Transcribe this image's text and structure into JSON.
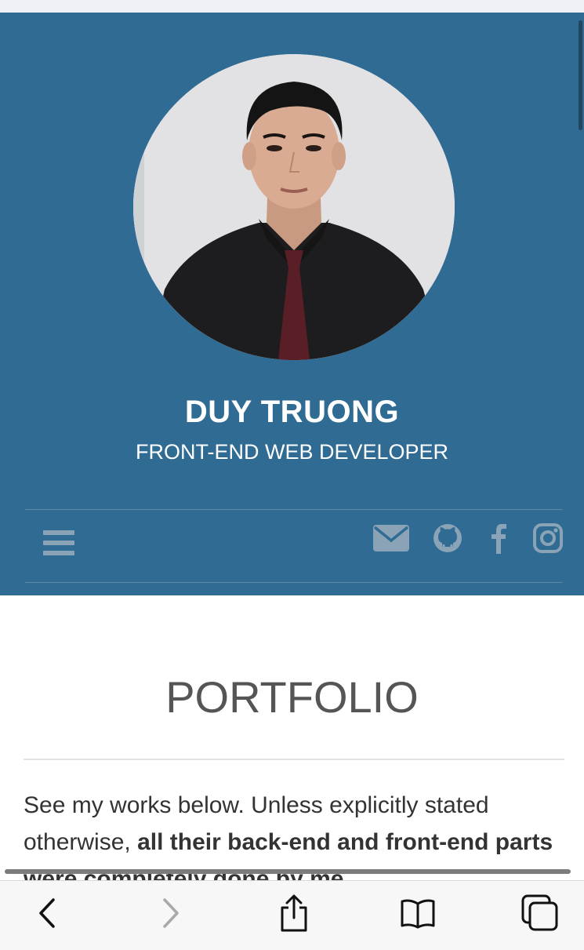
{
  "profile": {
    "name": "DUY TRUONG",
    "title": "FRONT-END WEB DEVELOPER"
  },
  "nav": {
    "menu_icon": "hamburger-icon",
    "social_icons": [
      "email-icon",
      "github-icon",
      "facebook-icon",
      "instagram-icon"
    ]
  },
  "portfolio": {
    "heading": "PORTFOLIO",
    "intro_plain": "See my works below. Unless explicitly stated otherwise, ",
    "intro_bold": "all their back-end and front-end parts were completely done by me."
  },
  "browser_toolbar": {
    "icons": [
      "back-icon",
      "forward-icon",
      "share-icon",
      "bookmarks-icon",
      "tabs-icon"
    ]
  },
  "colors": {
    "hero_bg": "#2f6b93",
    "icon_gray": "#8aa3b6",
    "text_dark": "#333333"
  }
}
